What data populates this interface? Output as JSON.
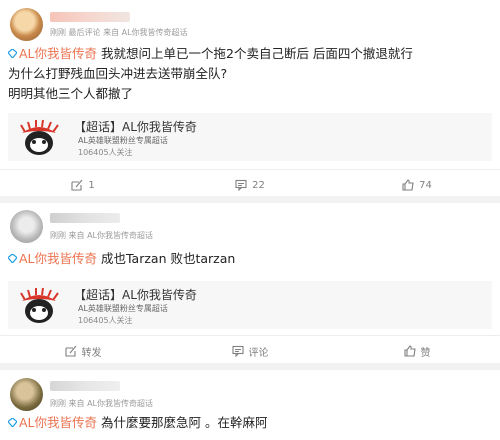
{
  "colors": {
    "topic_link": "#eb7350",
    "page_bg": "#f2f2f2",
    "card_bg": "#ffffff",
    "meta_text": "#9a9a9a"
  },
  "posts": [
    {
      "meta": "刚刚 最后评论  来自 AL你我皆传奇超话",
      "topic_link": "AL你我皆传奇",
      "text_line1": " 我就想问上单已一个拖2个卖自己断后 后面四个撤退就行",
      "text_line2": "为什么打野残血回头冲进去送带崩全队?",
      "text_line3": "明明其他三个人都撤了",
      "topic_card": {
        "title": "【超话】AL你我皆传奇",
        "subtitle": "AL英雄联盟粉丝专属超话",
        "followers": "106405人关注"
      },
      "actions": {
        "repost": "1",
        "comment": "22",
        "like": "74"
      }
    },
    {
      "meta": "刚刚  来自 AL你我皆传奇超话",
      "topic_link": "AL你我皆传奇",
      "text_line1": " 成也Tarzan 败也tarzan",
      "topic_card": {
        "title": "【超话】AL你我皆传奇",
        "subtitle": "AL英雄联盟粉丝专属超话",
        "followers": "106405人关注"
      },
      "actions": {
        "repost": "转发",
        "comment": "评论",
        "like": "赞"
      }
    },
    {
      "meta": "刚刚  来自 AL你我皆传奇超话",
      "topic_link": "AL你我皆传奇",
      "text_line1": " 為什麼要那麼急阿 。在幹麻阿"
    }
  ]
}
